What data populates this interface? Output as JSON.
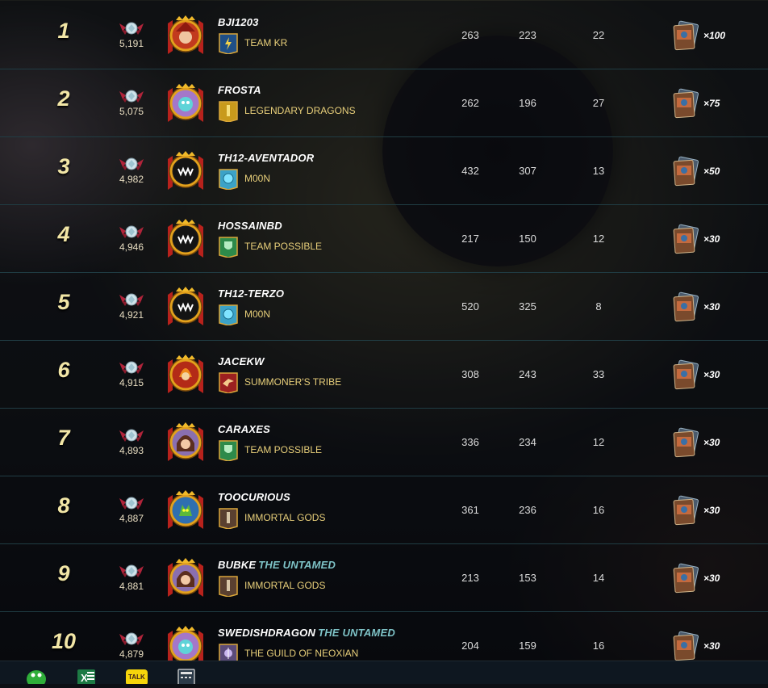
{
  "leaderboard": {
    "rows": [
      {
        "rank": "1",
        "rating": "5,191",
        "player": "BJI1203",
        "title": "",
        "guild": "TEAM KR",
        "stat1": "263",
        "stat2": "223",
        "stat3": "22",
        "reward": "×100",
        "colors": {
          "avatar": "#c23a1e",
          "guild_bg": "#1f4f87"
        },
        "avatar_icon": "red-hood-avatar-icon",
        "guild_icon": "lightning-banner-icon"
      },
      {
        "rank": "2",
        "rating": "5,075",
        "player": "FROSTA",
        "title": "",
        "guild": "LEGENDARY DRAGONS",
        "stat1": "262",
        "stat2": "196",
        "stat3": "27",
        "reward": "×75",
        "colors": {
          "avatar": "#a477c9",
          "guild_bg": "#c89a1c"
        },
        "avatar_icon": "blue-creature-avatar-icon",
        "guild_icon": "gold-banner-icon"
      },
      {
        "rank": "3",
        "rating": "4,982",
        "player": "TH12-AVENTADOR",
        "title": "",
        "guild": "M00N",
        "stat1": "432",
        "stat2": "307",
        "stat3": "13",
        "reward": "×50",
        "colors": {
          "avatar": "#1a1a1a",
          "guild_bg": "#3ba2c7"
        },
        "avatar_icon": "monster-mouth-avatar-icon",
        "guild_icon": "orb-banner-icon"
      },
      {
        "rank": "4",
        "rating": "4,946",
        "player": "HOSSAINBD",
        "title": "",
        "guild": "TEAM POSSIBLE",
        "stat1": "217",
        "stat2": "150",
        "stat3": "12",
        "reward": "×30",
        "colors": {
          "avatar": "#1a1a1a",
          "guild_bg": "#2d8a4a"
        },
        "avatar_icon": "monster-mouth-avatar-icon",
        "guild_icon": "shield-banner-icon"
      },
      {
        "rank": "5",
        "rating": "4,921",
        "player": "TH12-TERZO",
        "title": "",
        "guild": "M00N",
        "stat1": "520",
        "stat2": "325",
        "stat3": "8",
        "reward": "×30",
        "colors": {
          "avatar": "#1a1a1a",
          "guild_bg": "#3ba2c7"
        },
        "avatar_icon": "monster-mouth-avatar-icon",
        "guild_icon": "orb-banner-icon"
      },
      {
        "rank": "6",
        "rating": "4,915",
        "player": "JACEKW",
        "title": "",
        "guild": "SUMMONER'S TRIBE",
        "stat1": "308",
        "stat2": "243",
        "stat3": "33",
        "reward": "×30",
        "colors": {
          "avatar": "#b32a17",
          "guild_bg": "#9c2020"
        },
        "avatar_icon": "fire-spirit-avatar-icon",
        "guild_icon": "bird-banner-icon"
      },
      {
        "rank": "7",
        "rating": "4,893",
        "player": "CARAXES",
        "title": "",
        "guild": "TEAM POSSIBLE",
        "stat1": "336",
        "stat2": "234",
        "stat3": "12",
        "reward": "×30",
        "colors": {
          "avatar": "#8a6fb0",
          "guild_bg": "#2d8a4a"
        },
        "avatar_icon": "girl-avatar-icon",
        "guild_icon": "shield-banner-icon"
      },
      {
        "rank": "8",
        "rating": "4,887",
        "player": "TOOCURIOUS",
        "title": "",
        "guild": "IMMORTAL GODS",
        "stat1": "361",
        "stat2": "236",
        "stat3": "16",
        "reward": "×30",
        "colors": {
          "avatar": "#2f6fb0",
          "guild_bg": "#5a4030"
        },
        "avatar_icon": "green-goblin-avatar-icon",
        "guild_icon": "pillar-banner-icon"
      },
      {
        "rank": "9",
        "rating": "4,881",
        "player": "BUBKE",
        "title": "THE UNTAMED",
        "guild": "IMMORTAL GODS",
        "stat1": "213",
        "stat2": "153",
        "stat3": "14",
        "reward": "×30",
        "colors": {
          "avatar": "#8a6fb0",
          "guild_bg": "#5a4030"
        },
        "avatar_icon": "girl-avatar-icon",
        "guild_icon": "pillar-banner-icon"
      },
      {
        "rank": "10",
        "rating": "4,879",
        "player": "SWEDISHDRAGON",
        "title": "THE UNTAMED",
        "guild": "THE GUILD OF NEOXIAN",
        "stat1": "204",
        "stat2": "159",
        "stat3": "16",
        "reward": "×30",
        "colors": {
          "avatar": "#a477c9",
          "guild_bg": "#5b4b7a"
        },
        "avatar_icon": "blue-creature-avatar-icon",
        "guild_icon": "crest-banner-icon"
      }
    ]
  },
  "taskbar": {
    "items": [
      {
        "icon": "green-app-icon"
      },
      {
        "icon": "excel-icon"
      },
      {
        "icon": "kakaotalk-icon",
        "label": "TALK"
      },
      {
        "icon": "calculator-icon"
      }
    ]
  },
  "colors": {
    "row_divider": "#3f7d85",
    "rank": "#f2e6a6",
    "guild_text": "#e8cf7a",
    "title_text": "#7ec3c7"
  }
}
